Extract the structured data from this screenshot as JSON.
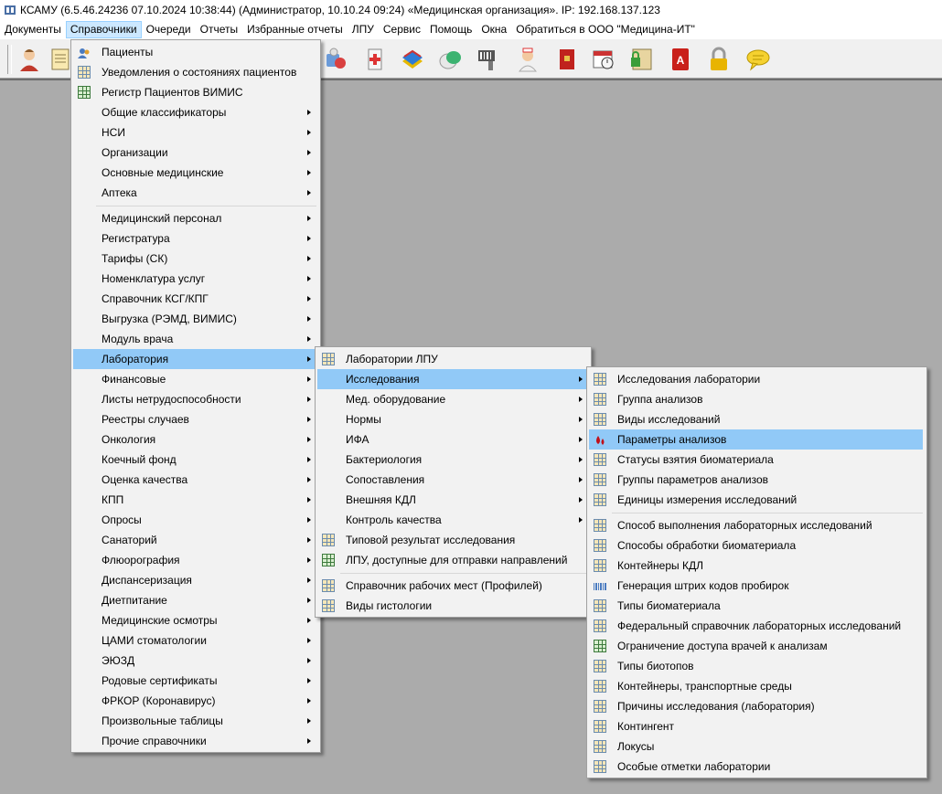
{
  "window": {
    "title": "КСАМУ (6.5.46.24236 07.10.2024 10:38:44) (Администратор, 10.10.24 09:24)  «Медицинская организация». IP: 192.168.137.123"
  },
  "menubar": [
    "Документы",
    "Справочники",
    "Очереди",
    "Отчеты",
    "Избранные отчеты",
    "ЛПУ",
    "Сервис",
    "Помощь",
    "Окна",
    "Обратиться в ООО \"Медицина-ИТ\""
  ],
  "menu1": {
    "items": [
      {
        "label": "Пациенты",
        "icon": "patient-icon"
      },
      {
        "label": "Уведомления о состояниях пациентов",
        "icon": "table-icon"
      },
      {
        "label": "Регистр Пациентов ВИМИС",
        "icon": "green-table-icon"
      },
      {
        "label": "Общие классификаторы",
        "submenu": true
      },
      {
        "label": "НСИ",
        "submenu": true
      },
      {
        "label": "Организации",
        "submenu": true
      },
      {
        "label": "Основные медицинские",
        "submenu": true
      },
      {
        "label": "Аптека",
        "submenu": true
      },
      {
        "separator": true
      },
      {
        "label": "Медицинский персонал",
        "submenu": true
      },
      {
        "label": "Регистратура",
        "submenu": true
      },
      {
        "label": "Тарифы (СК)",
        "submenu": true
      },
      {
        "label": "Номенклатура услуг",
        "submenu": true
      },
      {
        "label": "Справочник КСГ/КПГ",
        "submenu": true
      },
      {
        "label": "Выгрузка (РЭМД, ВИМИС)",
        "submenu": true
      },
      {
        "label": "Модуль врача",
        "submenu": true
      },
      {
        "label": "Лаборатория",
        "submenu": true,
        "selected": true
      },
      {
        "label": "Финансовые",
        "submenu": true
      },
      {
        "label": "Листы нетрудоспособности",
        "submenu": true
      },
      {
        "label": "Реестры случаев",
        "submenu": true
      },
      {
        "label": "Онкология",
        "submenu": true
      },
      {
        "label": "Коечный фонд",
        "submenu": true
      },
      {
        "label": "Оценка качества",
        "submenu": true
      },
      {
        "label": "КПП",
        "submenu": true
      },
      {
        "label": "Опросы",
        "submenu": true
      },
      {
        "label": "Санаторий",
        "submenu": true
      },
      {
        "label": "Флюорография",
        "submenu": true
      },
      {
        "label": "Диспансеризация",
        "submenu": true
      },
      {
        "label": "Диетпитание",
        "submenu": true
      },
      {
        "label": "Медицинские осмотры",
        "submenu": true
      },
      {
        "label": "ЦАМИ стоматологии",
        "submenu": true
      },
      {
        "label": "ЭЮЗД",
        "submenu": true
      },
      {
        "label": "Родовые сертификаты",
        "submenu": true
      },
      {
        "label": "ФРКОР (Коронавирус)",
        "submenu": true
      },
      {
        "label": "Произвольные таблицы",
        "submenu": true
      },
      {
        "label": "Прочие справочники",
        "submenu": true
      }
    ]
  },
  "menu2": {
    "items": [
      {
        "label": "Лаборатории ЛПУ",
        "icon": "table-icon"
      },
      {
        "label": "Исследования",
        "submenu": true,
        "selected": true
      },
      {
        "label": "Мед. оборудование",
        "submenu": true
      },
      {
        "label": "Нормы",
        "submenu": true
      },
      {
        "label": "ИФА",
        "submenu": true
      },
      {
        "label": "Бактериология",
        "submenu": true
      },
      {
        "label": "Сопоставления",
        "submenu": true
      },
      {
        "label": "Внешняя КДЛ",
        "submenu": true
      },
      {
        "label": "Контроль качества",
        "submenu": true
      },
      {
        "label": "Типовой результат исследования",
        "icon": "table-icon"
      },
      {
        "label": "ЛПУ, доступные для отправки направлений",
        "icon": "green-table-icon"
      },
      {
        "separator": true
      },
      {
        "label": "Справочник рабочих мест (Профилей)",
        "icon": "table-icon"
      },
      {
        "label": "Виды гистологии",
        "icon": "table-icon"
      }
    ]
  },
  "menu3": {
    "items": [
      {
        "label": "Исследования лаборатории",
        "icon": "table-icon"
      },
      {
        "label": "Группа анализов",
        "icon": "table-icon"
      },
      {
        "label": "Виды исследований",
        "icon": "table-icon"
      },
      {
        "label": "Параметры анализов",
        "icon": "blood-drop-icon",
        "selected": true
      },
      {
        "label": "Статусы взятия биоматериала",
        "icon": "table-icon"
      },
      {
        "label": "Группы параметров анализов",
        "icon": "table-icon"
      },
      {
        "label": "Единицы измерения исследований",
        "icon": "table-icon"
      },
      {
        "separator": true
      },
      {
        "label": "Способ выполнения лабораторных исследований",
        "icon": "table-icon"
      },
      {
        "label": "Способы обработки биоматериала",
        "icon": "table-icon"
      },
      {
        "label": "Контейнеры КДЛ",
        "icon": "table-icon"
      },
      {
        "label": "Генерация штрих кодов пробирок",
        "icon": "barcode-icon"
      },
      {
        "label": "Типы биоматериала",
        "icon": "table-icon"
      },
      {
        "label": "Федеральный справочник лабораторных исследований",
        "icon": "table-icon"
      },
      {
        "label": "Ограничение доступа врачей к анализам",
        "icon": "green-table-icon"
      },
      {
        "label": "Типы биотопов",
        "icon": "table-icon"
      },
      {
        "label": "Контейнеры, транспортные среды",
        "icon": "table-icon"
      },
      {
        "label": "Причины исследования (лаборатория)",
        "icon": "table-icon"
      },
      {
        "label": "Контингент",
        "icon": "table-icon"
      },
      {
        "label": "Локусы",
        "icon": "table-icon"
      },
      {
        "label": "Особые отметки лаборатории",
        "icon": "table-icon"
      }
    ]
  },
  "toolbar": {
    "icons": [
      "doctor-icon",
      "document-icon",
      "pills-icon",
      "medical-box-icon",
      "books-icon",
      "capsule-icon",
      "barcode-scanner-icon",
      "nurse-icon",
      "red-book-icon",
      "calendar-icon",
      "lock-book-icon",
      "pdf-icon",
      "padlock-icon",
      "speech-bubble-icon"
    ]
  }
}
